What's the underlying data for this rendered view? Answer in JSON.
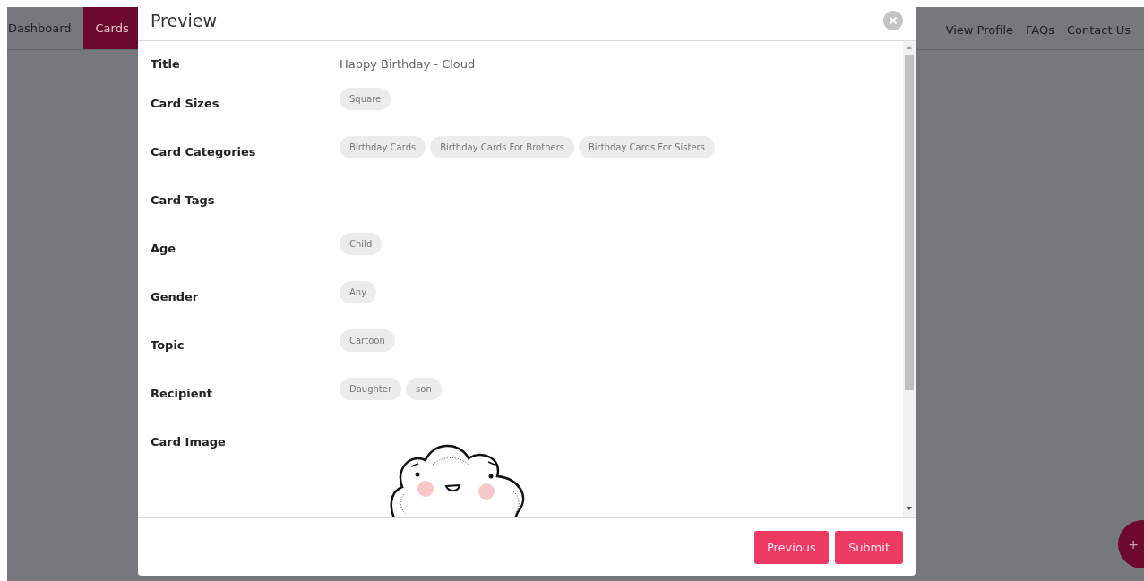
{
  "nav": {
    "left": [
      {
        "label": "Dashboard",
        "selected": false
      },
      {
        "label": "Cards",
        "selected": true
      }
    ],
    "right": [
      "View Profile",
      "FAQs",
      "Contact Us"
    ]
  },
  "modal": {
    "title": "Preview",
    "rows": [
      {
        "label": "Title",
        "kind": "text",
        "value": "Happy Birthday - Cloud"
      },
      {
        "label": "Card Sizes",
        "kind": "chips",
        "chips": [
          "Square"
        ]
      },
      {
        "label": "Card Categories",
        "kind": "chips",
        "chips": [
          "Birthday Cards",
          "Birthday Cards For Brothers",
          "Birthday Cards For Sisters"
        ]
      },
      {
        "label": "Card Tags",
        "kind": "chips"
      },
      {
        "label": "Age",
        "kind": "chips",
        "chips": [
          "Child"
        ]
      },
      {
        "label": "Gender",
        "kind": "chips",
        "chips": [
          "Any"
        ]
      },
      {
        "label": "Topic",
        "kind": "chips",
        "chips": [
          "Cartoon"
        ]
      },
      {
        "label": "Recipient",
        "kind": "chips",
        "chips": [
          "Daughter",
          "son"
        ]
      },
      {
        "label": "Card Image",
        "kind": "image"
      }
    ],
    "buttons": [
      "Previous",
      "Submit"
    ]
  },
  "fab": "+"
}
